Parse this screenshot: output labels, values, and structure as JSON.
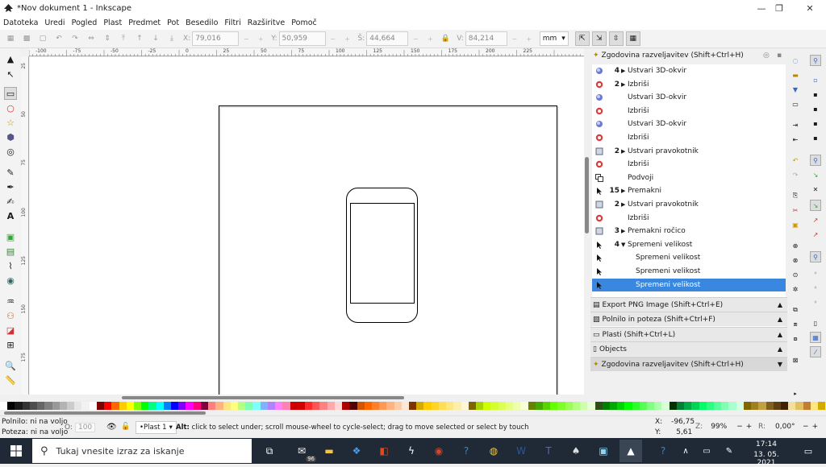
{
  "window": {
    "title": "*Nov dokument 1 - Inkscape",
    "minimize_icon": "minimize-icon",
    "maximize_icon": "maximize-icon",
    "close_icon": "close-icon"
  },
  "menu": [
    "Datoteka",
    "Uredi",
    "Pogled",
    "Plast",
    "Predmet",
    "Pot",
    "Besedilo",
    "Filtri",
    "Razširitve",
    "Pomoč"
  ],
  "controls": {
    "x_label": "X:",
    "x_value": "79,016",
    "y_label": "Y:",
    "y_value": "50,959",
    "w_label": "Š:",
    "w_value": "44,664",
    "h_label": "V:",
    "h_value": "84,214",
    "unit": "mm"
  },
  "ruler": {
    "h_labels": [
      "-100",
      "-75",
      "-50",
      "-25",
      "0",
      "25",
      "50",
      "75",
      "100",
      "125",
      "150",
      "175",
      "200",
      "225"
    ],
    "v_labels": [
      "25",
      "50",
      "75",
      "100",
      "125",
      "150",
      "175"
    ]
  },
  "history_panel": {
    "title": "Zgodovina razveljavitev  (Shift+Ctrl+H)",
    "rows": [
      {
        "icon": "3d-box-icon",
        "count": "4",
        "expand": "▶",
        "label": "Ustvari 3D-okvir"
      },
      {
        "icon": "delete-icon",
        "count": "2",
        "expand": "▶",
        "label": "Izbriši"
      },
      {
        "icon": "3d-box-icon",
        "count": "",
        "expand": "",
        "label": "Ustvari 3D-okvir"
      },
      {
        "icon": "delete-icon",
        "count": "",
        "expand": "",
        "label": "Izbriši"
      },
      {
        "icon": "3d-box-icon",
        "count": "",
        "expand": "",
        "label": "Ustvari 3D-okvir"
      },
      {
        "icon": "delete-icon",
        "count": "",
        "expand": "",
        "label": "Izbriši"
      },
      {
        "icon": "rectangle-icon",
        "count": "2",
        "expand": "▶",
        "label": "Ustvari pravokotnik"
      },
      {
        "icon": "delete-icon",
        "count": "",
        "expand": "",
        "label": "Izbriši"
      },
      {
        "icon": "duplicate-icon",
        "count": "",
        "expand": "",
        "label": "Podvoji"
      },
      {
        "icon": "arrow-icon",
        "count": "15",
        "expand": "▶",
        "label": "Premakni"
      },
      {
        "icon": "rectangle-icon",
        "count": "2",
        "expand": "▶",
        "label": "Ustvari pravokotnik"
      },
      {
        "icon": "delete-icon",
        "count": "",
        "expand": "",
        "label": "Izbriši"
      },
      {
        "icon": "rectangle-icon",
        "count": "3",
        "expand": "▶",
        "label": "Premakni ročico"
      },
      {
        "icon": "arrow-icon",
        "count": "4",
        "expand": "▼",
        "label": "Spremeni velikost"
      },
      {
        "icon": "arrow-icon",
        "count": "",
        "expand": "",
        "label": "Spremeni velikost"
      },
      {
        "icon": "arrow-icon",
        "count": "",
        "expand": "",
        "label": "Spremeni velikost"
      },
      {
        "icon": "arrow-icon",
        "count": "",
        "expand": "",
        "label": "Spremeni velikost"
      }
    ]
  },
  "panels": [
    {
      "label": "Export PNG Image (Shift+Ctrl+E)"
    },
    {
      "label": "Polnilo in poteza  (Shift+Ctrl+F)"
    },
    {
      "label": "Plasti  (Shift+Ctrl+L)"
    },
    {
      "label": "Objects"
    },
    {
      "label": "Zgodovina razveljavitev  (Shift+Ctrl+H)"
    }
  ],
  "status": {
    "fill_label": "Polnilo:",
    "fill_value": "ni na voljo",
    "stroke_label": "Poteza:",
    "stroke_value": "ni na voljo",
    "opacity_label": "O:",
    "opacity_value": "100",
    "layer": "•Plast 1",
    "message_bold": "Alt:",
    "message": " click to select under; scroll mouse-wheel to cycle-select; drag to move selected or select by touch",
    "cx_label": "X:",
    "cx_value": "-96,75",
    "cy_label": "Y:",
    "cy_value": "5,61",
    "zoom_label": "Z:",
    "zoom_value": "99%",
    "rot_label": "R:",
    "rot_value": "0,00°"
  },
  "taskbar": {
    "search_placeholder": "Tukaj vnesite izraz za iskanje",
    "mail_badge": "96",
    "time": "17:14",
    "date": "13. 05. 2021"
  },
  "colors": {
    "selection": "#3a87e0",
    "taskbar": "#1f2a36"
  }
}
